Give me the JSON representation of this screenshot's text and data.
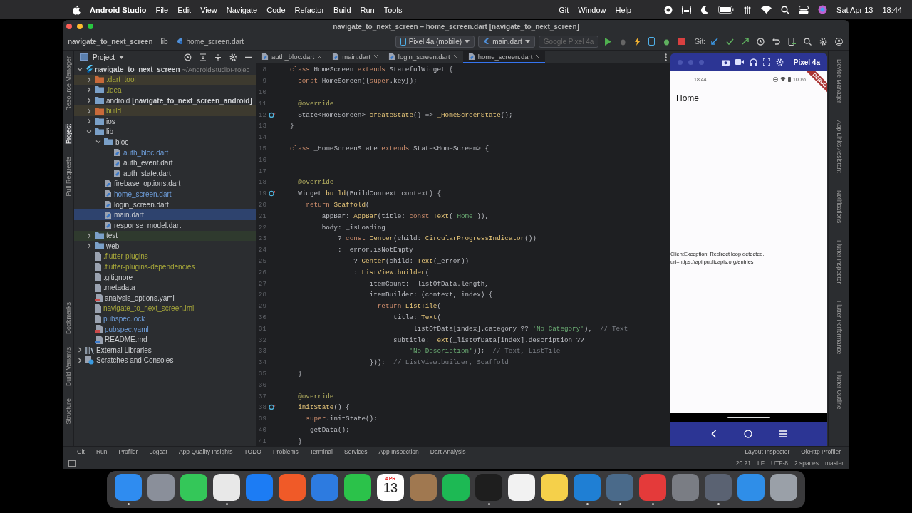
{
  "menubar": {
    "app": "Android Studio",
    "menus": [
      "File",
      "Edit",
      "View",
      "Navigate",
      "Code",
      "Refactor",
      "Build",
      "Run",
      "Tools"
    ],
    "right_menus": [
      "Git",
      "Window",
      "Help"
    ],
    "date": "Sat Apr 13",
    "time": "18:44"
  },
  "window": {
    "title": "navigate_to_next_screen – home_screen.dart [navigate_to_next_screen]"
  },
  "toolbar": {
    "breadcrumb": [
      "navigate_to_next_screen",
      "lib",
      "home_screen.dart"
    ],
    "device": "Pixel 4a (mobile)",
    "config": "main.dart",
    "target": {
      "label": "Google Pixel 4a",
      "disabled": true
    },
    "git_label": "Git:"
  },
  "left_strip_top": [
    {
      "label": "Resource Manager",
      "selected": false
    },
    {
      "label": "Project",
      "selected": true
    },
    {
      "label": "Pull Requests",
      "selected": false
    }
  ],
  "left_strip_bottom": [
    {
      "label": "Bookmarks",
      "selected": false
    },
    {
      "label": "Build Variants",
      "selected": false
    },
    {
      "label": "Structure",
      "selected": false
    }
  ],
  "project": {
    "title": "Project",
    "tree": [
      {
        "name": "navigate_to_next_screen",
        "suffix": "~/AndroidStudioProjec",
        "kind": "module",
        "expanded": true,
        "selected": false,
        "children": [
          {
            "name": ".dart_tool",
            "kind": "folder",
            "ignored": true,
            "excluded": true,
            "expanded": false,
            "selected": false
          },
          {
            "name": ".idea",
            "kind": "folder",
            "ignored": true,
            "expanded": false,
            "selected": false
          },
          {
            "name": "android",
            "suffix": "[navigate_to_next_screen_android]",
            "kind": "folder",
            "expanded": false,
            "selected": false
          },
          {
            "name": "build",
            "kind": "folder",
            "ignored": true,
            "excluded": true,
            "expanded": false,
            "selected": false
          },
          {
            "name": "ios",
            "kind": "folder",
            "expanded": false,
            "selected": false
          },
          {
            "name": "lib",
            "kind": "folder",
            "expanded": true,
            "selected": false,
            "children": [
              {
                "name": "bloc",
                "kind": "folder",
                "expanded": true,
                "selected": false,
                "children": [
                  {
                    "name": "auth_bloc.dart",
                    "kind": "dart",
                    "modified": true,
                    "selected": false
                  },
                  {
                    "name": "auth_event.dart",
                    "kind": "dart",
                    "selected": false
                  },
                  {
                    "name": "auth_state.dart",
                    "kind": "dart",
                    "selected": false
                  }
                ]
              },
              {
                "name": "firebase_options.dart",
                "kind": "dart",
                "selected": false
              },
              {
                "name": "home_screen.dart",
                "kind": "dart",
                "modified": true,
                "selected": false
              },
              {
                "name": "login_screen.dart",
                "kind": "dart",
                "selected": false
              },
              {
                "name": "main.dart",
                "kind": "dart",
                "selected": true
              },
              {
                "name": "response_model.dart",
                "kind": "dart",
                "selected": false
              }
            ]
          },
          {
            "name": "test",
            "kind": "folder",
            "test_root": true,
            "expanded": false,
            "selected": false
          },
          {
            "name": "web",
            "kind": "folder",
            "expanded": false,
            "selected": false
          },
          {
            "name": ".flutter-plugins",
            "kind": "file",
            "ignored": true,
            "selected": false
          },
          {
            "name": ".flutter-plugins-dependencies",
            "kind": "file",
            "ignored": true,
            "selected": false
          },
          {
            "name": ".gitignore",
            "kind": "file",
            "selected": false
          },
          {
            "name": ".metadata",
            "kind": "file",
            "selected": false
          },
          {
            "name": "analysis_options.yaml",
            "kind": "yaml",
            "selected": false
          },
          {
            "name": "navigate_to_next_screen.iml",
            "kind": "file",
            "ignored": true,
            "selected": false
          },
          {
            "name": "pubspec.lock",
            "kind": "file",
            "modified": true,
            "selected": false
          },
          {
            "name": "pubspec.yaml",
            "kind": "yaml",
            "modified": true,
            "selected": false
          },
          {
            "name": "README.md",
            "kind": "md",
            "selected": false
          }
        ]
      },
      {
        "name": "External Libraries",
        "kind": "library",
        "expanded": false,
        "selected": false
      },
      {
        "name": "Scratches and Consoles",
        "kind": "scratch",
        "expanded": false,
        "selected": false
      }
    ]
  },
  "editor": {
    "tabs": [
      {
        "label": "auth_bloc.dart",
        "selected": false
      },
      {
        "label": "main.dart",
        "selected": false
      },
      {
        "label": "login_screen.dart",
        "selected": false
      },
      {
        "label": "home_screen.dart",
        "selected": true
      }
    ],
    "lines": [
      {
        "num": "8",
        "segs": [
          {
            "kind": "kw",
            "text": "class"
          },
          {
            "kind": "txt",
            "text": " HomeScreen "
          },
          {
            "kind": "kw",
            "text": "extends"
          },
          {
            "kind": "txt",
            "text": " StatefulWidget {"
          }
        ]
      },
      {
        "num": "9",
        "segs": [
          {
            "kind": "kw",
            "text": "  const"
          },
          {
            "kind": "txt",
            "text": " HomeScreen({"
          },
          {
            "kind": "kw",
            "text": "super"
          },
          {
            "kind": "txt",
            "text": ".key});"
          }
        ]
      },
      {
        "num": "10"
      },
      {
        "num": "11",
        "segs": [
          {
            "kind": "ann",
            "text": "  @override"
          }
        ]
      },
      {
        "num": "12",
        "marker": true,
        "segs": [
          {
            "kind": "txt",
            "text": "  State<HomeScreen> "
          },
          {
            "kind": "fn",
            "text": "createState"
          },
          {
            "kind": "txt",
            "text": "() => "
          },
          {
            "kind": "fn",
            "text": "_HomeScreenState"
          },
          {
            "kind": "txt",
            "text": "();"
          }
        ]
      },
      {
        "num": "13",
        "segs": [
          {
            "kind": "txt",
            "text": "}"
          }
        ]
      },
      {
        "num": "14"
      },
      {
        "num": "15",
        "segs": [
          {
            "kind": "kw",
            "text": "class"
          },
          {
            "kind": "txt",
            "text": " _HomeScreenState "
          },
          {
            "kind": "kw",
            "text": "extends"
          },
          {
            "kind": "txt",
            "text": " State<HomeScreen> {"
          }
        ]
      },
      {
        "num": "16"
      },
      {
        "num": "17"
      },
      {
        "num": "18",
        "segs": [
          {
            "kind": "ann",
            "text": "  @override"
          }
        ]
      },
      {
        "num": "19",
        "marker": true,
        "segs": [
          {
            "kind": "txt",
            "text": "  Widget "
          },
          {
            "kind": "fn",
            "text": "build"
          },
          {
            "kind": "txt",
            "text": "(BuildContext context) {"
          }
        ]
      },
      {
        "num": "20",
        "segs": [
          {
            "kind": "kw",
            "text": "    return"
          },
          {
            "kind": "fn",
            "text": " Scaffold"
          },
          {
            "kind": "txt",
            "text": "("
          }
        ]
      },
      {
        "num": "21",
        "segs": [
          {
            "kind": "txt",
            "text": "        appBar: "
          },
          {
            "kind": "fn",
            "text": "AppBar"
          },
          {
            "kind": "txt",
            "text": "(title: "
          },
          {
            "kind": "kw",
            "text": "const"
          },
          {
            "kind": "fn",
            "text": " Text"
          },
          {
            "kind": "txt",
            "text": "("
          },
          {
            "kind": "str",
            "text": "'Home'"
          },
          {
            "kind": "txt",
            "text": ")),"
          }
        ]
      },
      {
        "num": "22",
        "segs": [
          {
            "kind": "txt",
            "text": "        body: _isLoading"
          }
        ]
      },
      {
        "num": "23",
        "segs": [
          {
            "kind": "txt",
            "text": "            ? "
          },
          {
            "kind": "kw",
            "text": "const"
          },
          {
            "kind": "fn",
            "text": " Center"
          },
          {
            "kind": "txt",
            "text": "(child: "
          },
          {
            "kind": "fn",
            "text": "CircularProgressIndicator"
          },
          {
            "kind": "txt",
            "text": "())"
          }
        ]
      },
      {
        "num": "24",
        "segs": [
          {
            "kind": "txt",
            "text": "            : _error.isNotEmpty"
          }
        ]
      },
      {
        "num": "25",
        "segs": [
          {
            "kind": "txt",
            "text": "                ? "
          },
          {
            "kind": "fn",
            "text": "Center"
          },
          {
            "kind": "txt",
            "text": "(child: "
          },
          {
            "kind": "fn",
            "text": "Text"
          },
          {
            "kind": "txt",
            "text": "(_error))"
          }
        ]
      },
      {
        "num": "26",
        "segs": [
          {
            "kind": "txt",
            "text": "                : "
          },
          {
            "kind": "fn",
            "text": "ListView.builder"
          },
          {
            "kind": "txt",
            "text": "("
          }
        ]
      },
      {
        "num": "27",
        "segs": [
          {
            "kind": "txt",
            "text": "                    itemCount: _listOfData.length,"
          }
        ]
      },
      {
        "num": "28",
        "segs": [
          {
            "kind": "txt",
            "text": "                    itemBuilder: (context, index) {"
          }
        ]
      },
      {
        "num": "29",
        "segs": [
          {
            "kind": "kw",
            "text": "                      return"
          },
          {
            "kind": "fn",
            "text": " ListTile"
          },
          {
            "kind": "txt",
            "text": "("
          }
        ]
      },
      {
        "num": "30",
        "segs": [
          {
            "kind": "txt",
            "text": "                          title: "
          },
          {
            "kind": "fn",
            "text": "Text"
          },
          {
            "kind": "txt",
            "text": "("
          }
        ]
      },
      {
        "num": "31",
        "segs": [
          {
            "kind": "txt",
            "text": "                              _listOfData[index].category ?? "
          },
          {
            "kind": "str",
            "text": "'No Category'"
          },
          {
            "kind": "txt",
            "text": "),  "
          },
          {
            "kind": "cm",
            "text": "// Text"
          }
        ]
      },
      {
        "num": "32",
        "segs": [
          {
            "kind": "txt",
            "text": "                          subtitle: "
          },
          {
            "kind": "fn",
            "text": "Text"
          },
          {
            "kind": "txt",
            "text": "(_listOfData[index].description ??"
          }
        ]
      },
      {
        "num": "33",
        "segs": [
          {
            "kind": "str",
            "text": "                              'No Description'"
          },
          {
            "kind": "txt",
            "text": "));  "
          },
          {
            "kind": "cm",
            "text": "// Text, ListTile"
          }
        ]
      },
      {
        "num": "34",
        "segs": [
          {
            "kind": "txt",
            "text": "                    }));  "
          },
          {
            "kind": "cm",
            "text": "// ListView.builder, Scaffold"
          }
        ]
      },
      {
        "num": "35",
        "segs": [
          {
            "kind": "txt",
            "text": "  }"
          }
        ]
      },
      {
        "num": "36"
      },
      {
        "num": "37",
        "segs": [
          {
            "kind": "ann",
            "text": "  @override"
          }
        ]
      },
      {
        "num": "38",
        "marker": true,
        "segs": [
          {
            "kind": "fn",
            "text": "  initState"
          },
          {
            "kind": "txt",
            "text": "() {"
          }
        ]
      },
      {
        "num": "39",
        "segs": [
          {
            "kind": "kw",
            "text": "    super"
          },
          {
            "kind": "txt",
            "text": ".initState();"
          }
        ]
      },
      {
        "num": "40",
        "segs": [
          {
            "kind": "txt",
            "text": "    _getData();"
          }
        ]
      },
      {
        "num": "41",
        "segs": [
          {
            "kind": "txt",
            "text": "  }"
          }
        ]
      }
    ]
  },
  "emulator": {
    "device": "Pixel 4a",
    "status_time": "18:44",
    "battery": "100%",
    "banner": "DEBUG",
    "app_title": "Home",
    "message": "ClientException: Redirect loop detected. uri=https://api.publicapis.org/entries"
  },
  "right_strip": [
    "Device Manager",
    "App Links Assistant",
    "Notifications",
    "Flutter Inspector",
    "Flutter Performance",
    "Flutter Outline"
  ],
  "bottom_tools": [
    "Git",
    "Run",
    "Profiler",
    "Logcat",
    "App Quality Insights",
    "TODO",
    "Problems",
    "Terminal",
    "Services",
    "App Inspection",
    "Dart Analysis"
  ],
  "bottom_right_tools": [
    "Layout Inspector",
    "OkHttp Profiler"
  ],
  "status_bar": [
    "20:21",
    "LF",
    "UTF-8",
    "2 spaces",
    "master"
  ],
  "dock": [
    {
      "kind": "app",
      "color": "#2f8cf0",
      "running": true
    },
    {
      "kind": "app",
      "color": "#8a8f9a"
    },
    {
      "kind": "app",
      "color": "#34c759"
    },
    {
      "kind": "app",
      "color": "#e8e8e8",
      "running": true
    },
    {
      "kind": "app",
      "color": "#1c7cf4"
    },
    {
      "kind": "app",
      "color": "#f05a28"
    },
    {
      "kind": "app",
      "color": "#2d7be0"
    },
    {
      "kind": "app",
      "color": "#2bc24a"
    },
    {
      "kind": "calendar",
      "color": "#ffffff",
      "month": "APR",
      "day": "13"
    },
    {
      "kind": "app",
      "color": "#a07850"
    },
    {
      "kind": "app",
      "color": "#1db954"
    },
    {
      "kind": "app",
      "color": "#1e1e1e",
      "running": true
    },
    {
      "kind": "app",
      "color": "#f2f2f2"
    },
    {
      "kind": "app",
      "color": "#f5d04a"
    },
    {
      "kind": "app",
      "color": "#1f7fd4",
      "running": true
    },
    {
      "kind": "app",
      "color": "#4a6a8a",
      "running": true
    },
    {
      "kind": "app",
      "color": "#e43a3a",
      "running": true
    },
    {
      "kind": "app",
      "color": "#7a7d84"
    },
    {
      "kind": "app",
      "color": "#5a6272",
      "running": true
    },
    {
      "kind": "app",
      "color": "#2f8ee8"
    },
    {
      "kind": "app",
      "color": "#9aa0a8"
    }
  ]
}
